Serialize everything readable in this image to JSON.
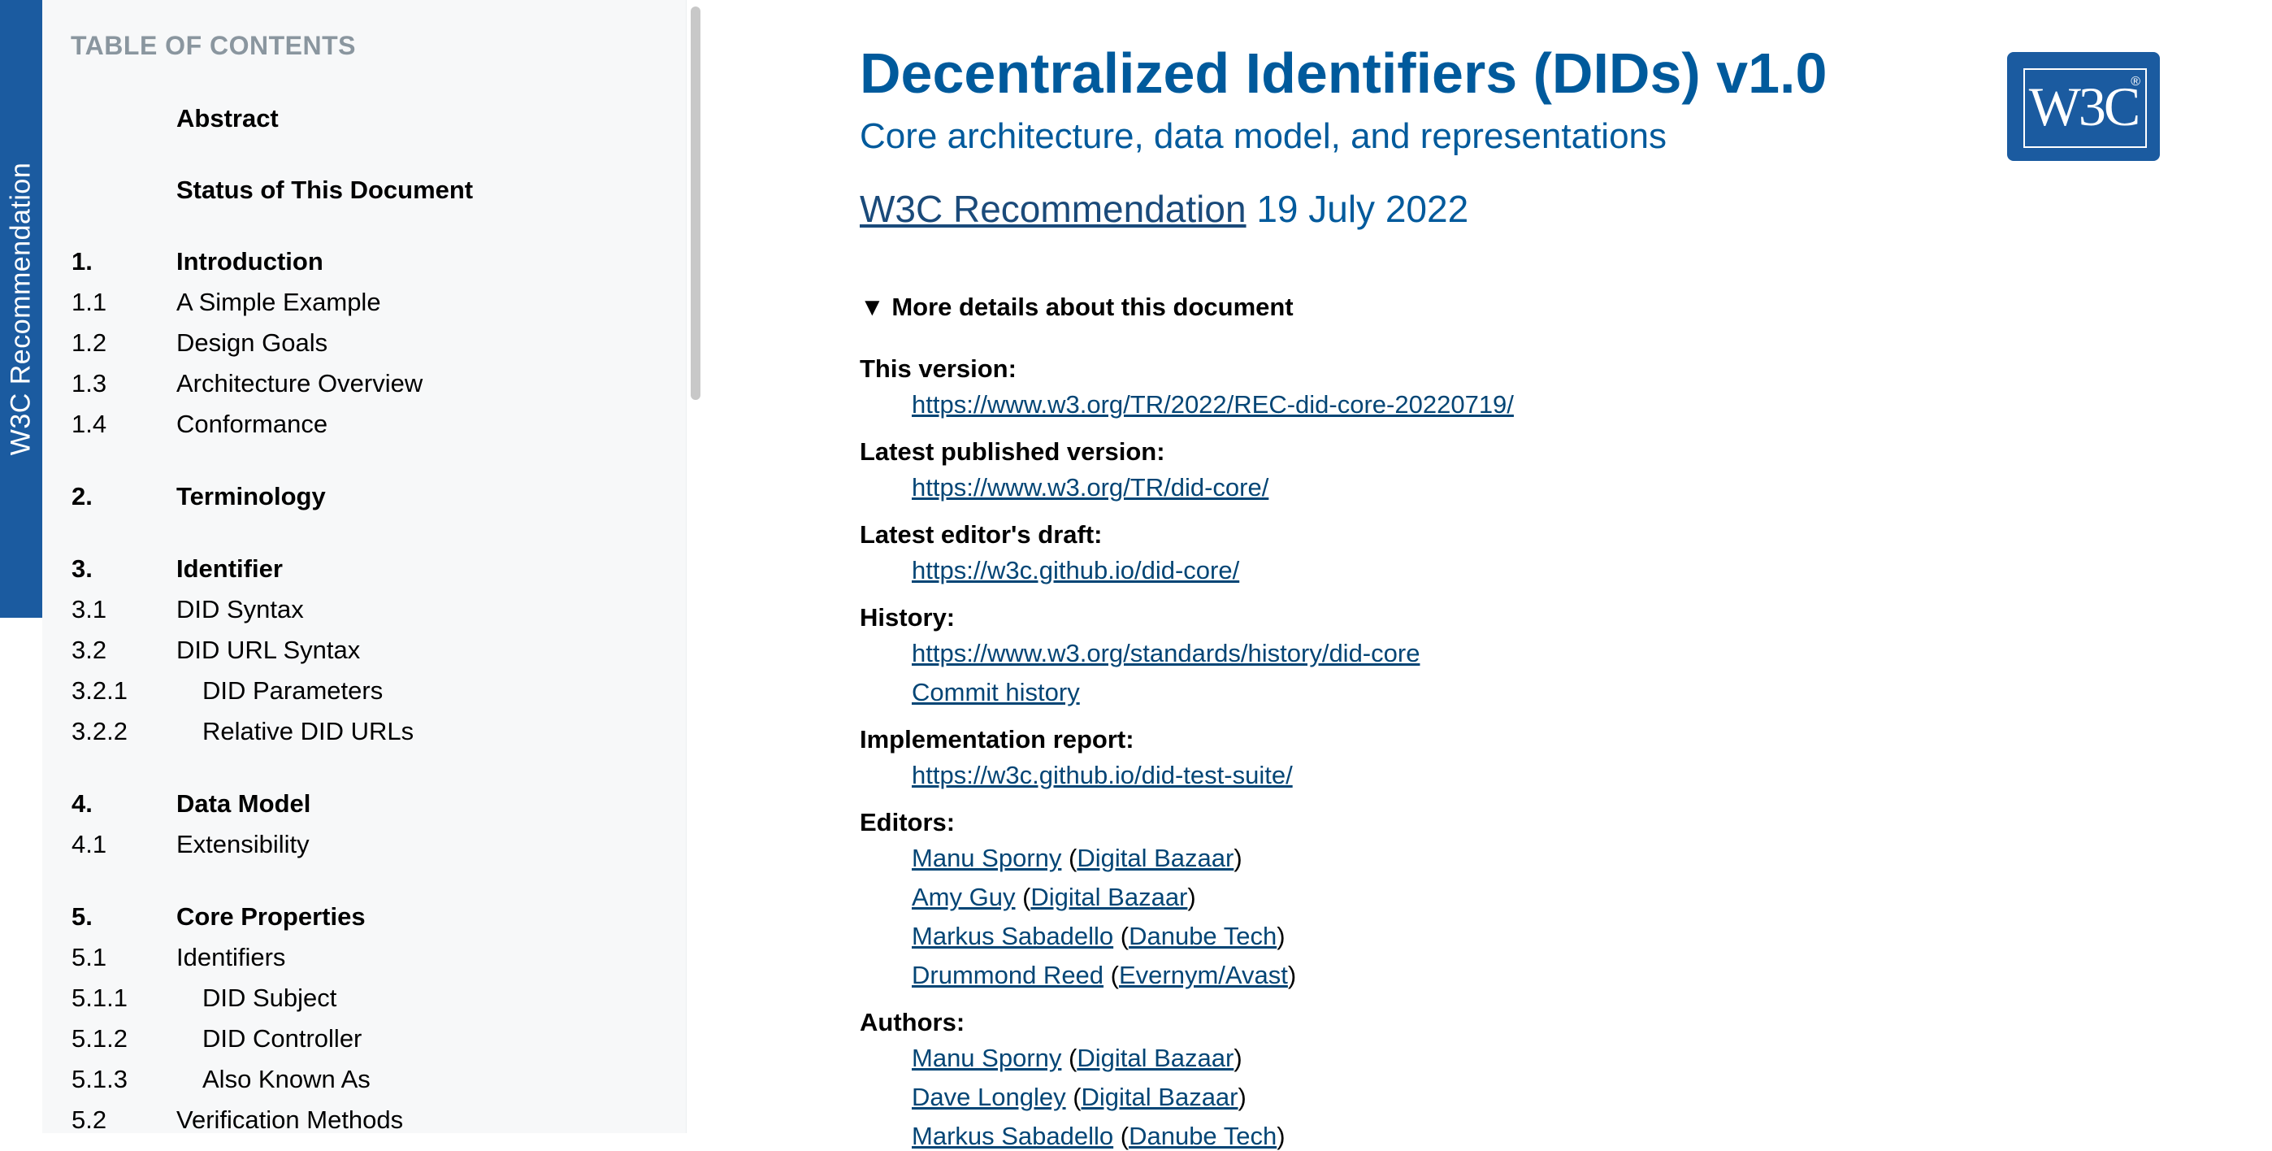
{
  "side_tab": {
    "label": "W3C Recommendation"
  },
  "toc": {
    "heading": "TABLE OF CONTENTS",
    "items": [
      {
        "num": "",
        "text": "Abstract"
      },
      {
        "num": "",
        "text": "Status of This Document"
      },
      {
        "num": "1.",
        "text": "Introduction"
      },
      {
        "num": "1.1",
        "text": "A Simple Example"
      },
      {
        "num": "1.2",
        "text": "Design Goals"
      },
      {
        "num": "1.3",
        "text": "Architecture Overview"
      },
      {
        "num": "1.4",
        "text": "Conformance"
      },
      {
        "num": "2.",
        "text": "Terminology"
      },
      {
        "num": "3.",
        "text": "Identifier"
      },
      {
        "num": "3.1",
        "text": "DID Syntax"
      },
      {
        "num": "3.2",
        "text": "DID URL Syntax"
      },
      {
        "num": "3.2.1",
        "text": "DID Parameters"
      },
      {
        "num": "3.2.2",
        "text": "Relative DID URLs"
      },
      {
        "num": "4.",
        "text": "Data Model"
      },
      {
        "num": "4.1",
        "text": "Extensibility"
      },
      {
        "num": "5.",
        "text": "Core Properties"
      },
      {
        "num": "5.1",
        "text": "Identifiers"
      },
      {
        "num": "5.1.1",
        "text": "DID Subject"
      },
      {
        "num": "5.1.2",
        "text": "DID Controller"
      },
      {
        "num": "5.1.3",
        "text": "Also Known As"
      },
      {
        "num": "5.2",
        "text": "Verification Methods"
      }
    ]
  },
  "header": {
    "title": "Decentralized Identifiers (DIDs) v1.0",
    "subtitle": "Core architecture, data model, and representations",
    "status_link": "W3C Recommendation",
    "date": "19 July 2022",
    "logo_text": "W3C",
    "logo_reg": "®"
  },
  "details": {
    "summary": "More details about this document",
    "marker": "▼",
    "this_version_label": "This version:",
    "this_version_url": "https://www.w3.org/TR/2022/REC-did-core-20220719/",
    "latest_published_label": "Latest published version:",
    "latest_published_url": "https://www.w3.org/TR/did-core/",
    "latest_draft_label": "Latest editor's draft:",
    "latest_draft_url": "https://w3c.github.io/did-core/",
    "history_label": "History:",
    "history_url": "https://www.w3.org/standards/history/did-core",
    "commit_history": "Commit history",
    "implementation_label": "Implementation report:",
    "implementation_url": "https://w3c.github.io/did-test-suite/",
    "editors_label": "Editors:",
    "editors": [
      {
        "name": "Manu Sporny",
        "org": "Digital Bazaar"
      },
      {
        "name": "Amy Guy",
        "org": "Digital Bazaar"
      },
      {
        "name": "Markus Sabadello",
        "org": "Danube Tech"
      },
      {
        "name": "Drummond Reed",
        "org": "Evernym/Avast"
      }
    ],
    "authors_label": "Authors:",
    "authors": [
      {
        "name": "Manu Sporny",
        "org": "Digital Bazaar"
      },
      {
        "name": "Dave Longley",
        "org": "Digital Bazaar"
      },
      {
        "name": "Markus Sabadello",
        "org": "Danube Tech"
      }
    ]
  },
  "colors": {
    "brand_blue": "#1b5ba0",
    "title_blue": "#005a9c",
    "link": "#034575"
  }
}
